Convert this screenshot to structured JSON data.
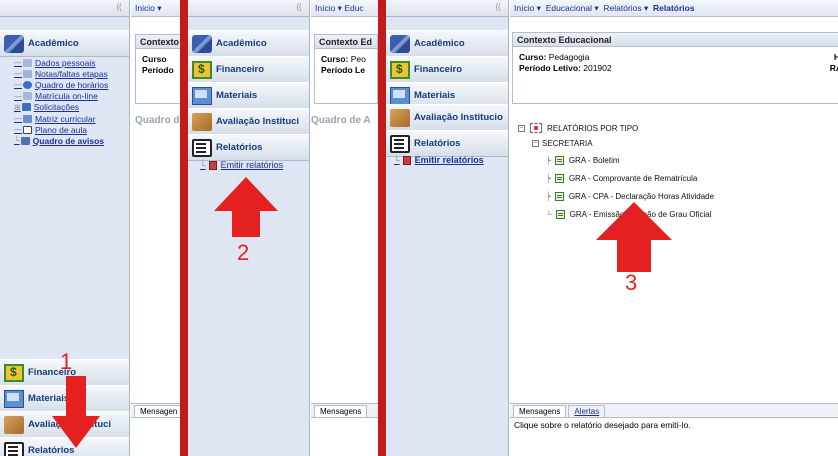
{
  "panel1": {
    "sidebar": {
      "collapse_label": "⟨⟨",
      "module_label": "Acadêmico",
      "items": [
        {
          "label": "Dados pessoais",
          "color": "#a7b9d6"
        },
        {
          "label": "Notas/faltas etapas",
          "color": "#9fb3d8"
        },
        {
          "label": "Quadro de horários",
          "color": "#3c6fc0"
        },
        {
          "label": "Matrícula on-line",
          "color": "#a7b9d6"
        },
        {
          "label": "Solicitações",
          "color": "#3c6fc0"
        },
        {
          "label": "Matriz curricular",
          "color": "#6d8fc7"
        },
        {
          "label": "Plano de aula",
          "color": "#444444"
        },
        {
          "label": "Quadro de avisos",
          "color": "#5570a8"
        }
      ],
      "bottom_modules": [
        "Financeiro",
        "Materiais",
        "Avaliação Instituci",
        "Relatórios"
      ]
    },
    "crumbs": "Inicio ▾",
    "ctx_title": "Contexto",
    "ctx_line1": "Curso",
    "ctx_line2": "Período",
    "gray_text": "Quadro d",
    "msg_tab": "Mensagen"
  },
  "panel2": {
    "sidebar": {
      "collapse_label": "⟨⟨",
      "modules": [
        "Acadêmico",
        "Financeiro",
        "Materiais",
        "Avaliação Instituci",
        "Relatórios"
      ],
      "sub_item": "Emitir relatórios"
    },
    "crumbs": "Início ▾  Educ",
    "ctx_title": "Contexto Ed",
    "ctx_line1_label": "Curso:",
    "ctx_line1_value": "Peo",
    "ctx_line2": "Período Le",
    "gray_text": "Quadro de A",
    "msg_tab": "Mensagens"
  },
  "panel3": {
    "sidebar": {
      "collapse_label": "⟨⟨",
      "modules": [
        "Acadêmico",
        "Financeiro",
        "Materiais",
        "Avaliação Institucio",
        "Relatórios"
      ],
      "sub_item": "Emitir relatórios"
    },
    "breadcrumb": {
      "home": "Início ▾",
      "educacional": "Educacional ▾",
      "relatorios": "Relatórios ▾",
      "current": "Relatórios"
    },
    "ctx_title": "Contexto Educacional",
    "curso_label": "Curso:",
    "curso_value": "Pedagogia",
    "periodo_label": "Período Letivo:",
    "periodo_value": "201902",
    "right_h": "H",
    "right_ra": "RA",
    "tree": {
      "root": "RELATÓRIOS POR TIPO",
      "folder": "SECRETARIA",
      "reports": [
        "GRA - Boletim",
        "GRA - Comprovante de Rematrícula",
        "GRA - CPA - Declaração Horas Atividade",
        "GRA - Emissão Colação de Grau Oficial"
      ]
    },
    "msg_tabs": [
      "Mensagens",
      "Alertas"
    ],
    "msg_text": "Clique sobre o relatório desejado para emití-lo."
  },
  "annotations": {
    "step1": "1",
    "step2": "2",
    "step3": "3",
    "arrow_color": "#e52020"
  }
}
